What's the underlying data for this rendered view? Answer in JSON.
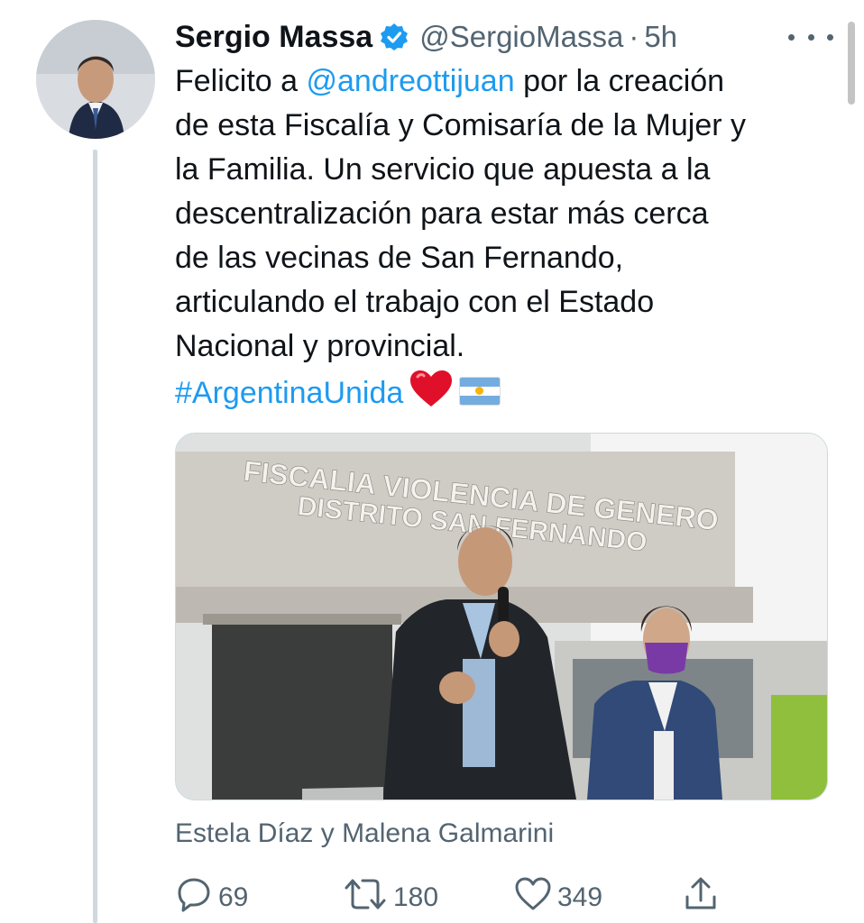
{
  "tweet": {
    "author_name": "Sergio Massa",
    "handle": "@SergioMassa",
    "separator": "·",
    "time": "5h",
    "text_lines": [
      {
        "before": "Felicito a ",
        "mention": "@andreottijuan",
        "after": " por la creación"
      },
      "de esta Fiscalía y Comisaría de la Mujer y",
      "la Familia. Un servicio que apuesta a la",
      "descentralización para estar más cerca",
      "de las vecinas de San Fernando,",
      "articulando el trabajo con el Estado",
      "Nacional y provincial."
    ],
    "hashtag": "#ArgentinaUnida",
    "emoji": [
      "red-heart",
      "argentina-flag"
    ],
    "photo": {
      "sign_line_1": "FISCALIA VIOLENCIA DE GENERO",
      "sign_line_2": "DISTRITO SAN FERNANDO"
    },
    "tagged": "Estela Díaz y Malena Galmarini",
    "actions": {
      "replies": "69",
      "retweets": "180",
      "likes": "349"
    },
    "colors": {
      "link": "#1d9bf0",
      "verified": "#1d9bf0",
      "secondary_text": "#536471",
      "heart": "#e0102b"
    }
  }
}
